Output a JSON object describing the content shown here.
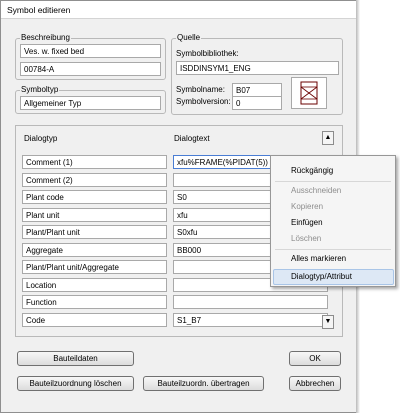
{
  "window": {
    "title": "Symbol editieren"
  },
  "beschreibung": {
    "legend": "Beschreibung",
    "line1": "Ves. w. fixed bed",
    "line2": "00784-A"
  },
  "quelle": {
    "legend": "Quelle",
    "library_label": "Symbolbibliothek:",
    "library_value": "ISDDINSYM1_ENG",
    "name_label": "Symbolname:",
    "name_value": "B07",
    "version_label": "Symbolversion:",
    "version_value": "0"
  },
  "symboltyp": {
    "legend": "Symboltyp",
    "value": "Allgemeiner Typ"
  },
  "grid": {
    "col1": "Dialogtyp",
    "col2": "Dialogtext",
    "rows": [
      {
        "label": "Comment (1)",
        "value": "xfu%FRAME(%PIDAT(5))"
      },
      {
        "label": "Comment (2)",
        "value": ""
      },
      {
        "label": "Plant code",
        "value": "S0"
      },
      {
        "label": "Plant unit",
        "value": "xfu"
      },
      {
        "label": "Plant/Plant unit",
        "value": "S0xfu"
      },
      {
        "label": "Aggregate",
        "value": "BB000"
      },
      {
        "label": "Plant/Plant unit/Aggregate",
        "value": ""
      },
      {
        "label": "Location",
        "value": ""
      },
      {
        "label": "Function",
        "value": ""
      },
      {
        "label": "Code",
        "value": "S1_B7"
      }
    ]
  },
  "buttons": {
    "bauteildaten": "Bauteildaten",
    "ok": "OK",
    "zuordnung_loeschen": "Bauteilzuordnung löschen",
    "zuordnung_uebertragen": "Bauteilzuordn. übertragen",
    "abbrechen": "Abbrechen"
  },
  "context_menu": {
    "items": [
      {
        "label": "Rückgängig",
        "enabled": true
      },
      {
        "label": "Ausschneiden",
        "enabled": false
      },
      {
        "label": "Kopieren",
        "enabled": false
      },
      {
        "label": "Einfügen",
        "enabled": true
      },
      {
        "label": "Löschen",
        "enabled": false
      },
      {
        "label": "Alles markieren",
        "enabled": true
      },
      {
        "label": "Dialogtyp/Attribut",
        "enabled": true,
        "highlighted": true
      }
    ]
  }
}
